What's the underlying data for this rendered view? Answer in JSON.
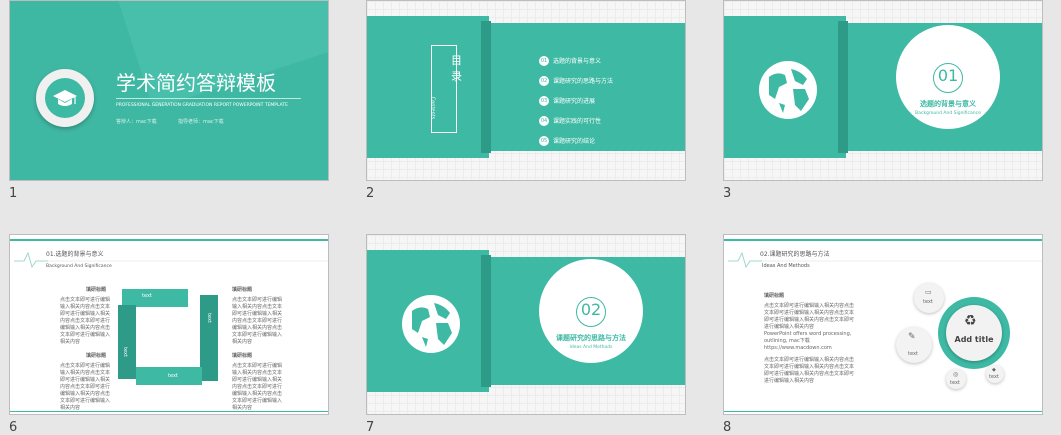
{
  "colors": {
    "teal": "#3db9a4",
    "teal_dark": "#2e9a88",
    "background": "#e7e7e7"
  },
  "slides": [
    {
      "number": "1",
      "title": "学术简约答辩模板",
      "subtitle": "PROFESSIONAL GENERATION GRADUATION REPORT POWERPOINT TEMPLATE",
      "presenter": "答辩人：mac下载",
      "advisor": "指导老师：mac下载",
      "icon": "graduation-cap-icon"
    },
    {
      "number": "2",
      "title_cn": "目录",
      "title_en": "Contents",
      "items": [
        {
          "n": "01",
          "text": "选题的背景与意义"
        },
        {
          "n": "02",
          "text": "课题研究的思路与方法"
        },
        {
          "n": "03",
          "text": "课题研究的进展"
        },
        {
          "n": "04",
          "text": "课题实践的可行性"
        },
        {
          "n": "05",
          "text": "课题研究的结论"
        }
      ]
    },
    {
      "number": "3",
      "section": "01",
      "title": "选题的背景与意义",
      "subtitle": "Background And Significance",
      "icon": "globe-icon"
    },
    {
      "number": "6",
      "section_title": "01.选题的背景与意义",
      "section_sub": "Background And Significance",
      "block_title": "填研标题",
      "block_text": "点击文本即可进行编辑输入相关内容点击文本即可进行编辑输入相关内容点击文本即可进行编辑输入相关内容点击文本即可进行编辑输入相关内容",
      "arrow_label": "text"
    },
    {
      "number": "7",
      "section": "02",
      "title": "课题研究的思路与方法",
      "subtitle": "Ideas And Methods",
      "icon": "globe-icon"
    },
    {
      "number": "8",
      "section_title": "02.课题研究的思路与方法",
      "section_sub": "Ideas And Methods",
      "block_title": "填研标题",
      "block_text": "点击文本即可进行编辑输入相关内容点击文本即可进行编辑输入相关内容点击文本即可进行编辑输入相关内容点击文本即可进行编辑输入相关内容",
      "note": "PowerPoint offers word processing, outlining, mac下载 https://www.macdown.com",
      "center_label": "Add title",
      "small_label": "text"
    }
  ]
}
